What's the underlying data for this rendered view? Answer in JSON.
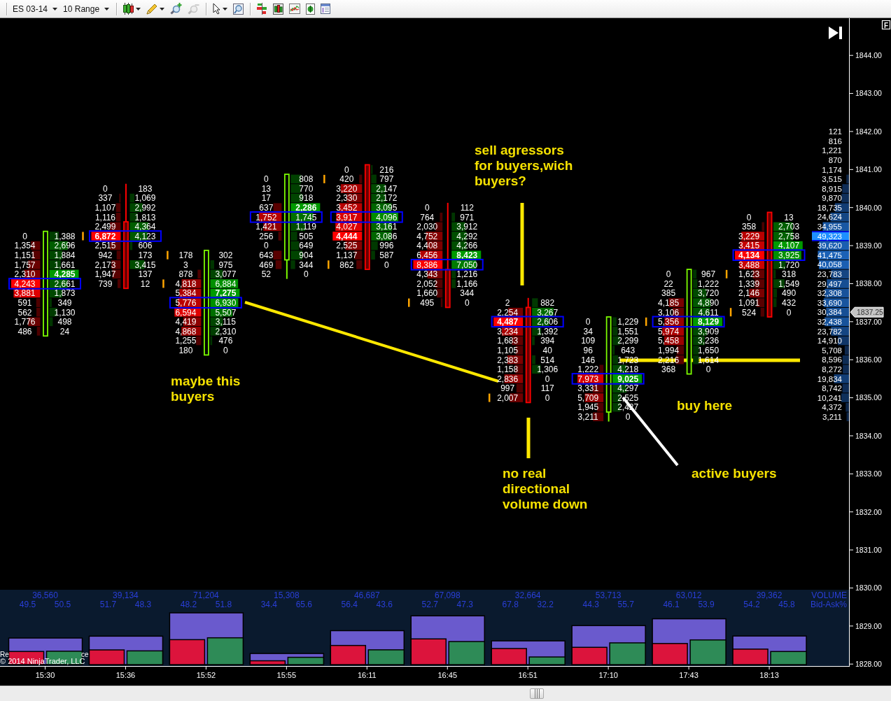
{
  "toolbar": {
    "instrument": "ES 03-14",
    "bar_type": "10 Range",
    "tool_groups": [
      [
        {
          "kind": "chart-style",
          "menu": true,
          "disabled": false
        },
        {
          "kind": "draw",
          "menu": true,
          "disabled": false
        },
        {
          "kind": "zoom-in",
          "menu": false,
          "disabled": false
        },
        {
          "kind": "zoom-out",
          "menu": false,
          "disabled": true
        }
      ],
      [
        {
          "kind": "pointer",
          "menu": true,
          "disabled": false
        },
        {
          "kind": "magnifier",
          "menu": false,
          "disabled": false
        }
      ],
      [
        {
          "kind": "volume-bars",
          "menu": false,
          "disabled": false
        },
        {
          "kind": "candles",
          "menu": false,
          "disabled": false
        },
        {
          "kind": "lines",
          "menu": false,
          "disabled": false
        },
        {
          "kind": "money",
          "menu": false,
          "disabled": false
        },
        {
          "kind": "panel",
          "menu": false,
          "disabled": false
        }
      ]
    ]
  },
  "chart": {
    "panel_flag": "F",
    "price_axis": [
      "1844.00",
      "1843.00",
      "1842.00",
      "1841.00",
      "1840.00",
      "1839.00",
      "1838.00",
      "1837.00",
      "1836.00",
      "1835.00",
      "1834.00",
      "1833.00",
      "1832.00",
      "1831.00",
      "1830.00",
      "1829.00",
      "1828.00"
    ],
    "last_price": "1837.25",
    "bars": [
      {
        "time": "15:30",
        "rising": true,
        "bid": [
          "0",
          "1,354",
          "1,151",
          "1,757",
          "2,310",
          "4,243",
          "3,881",
          "591",
          "562",
          "1,776",
          "486"
        ],
        "ask": [
          "1,388",
          "2,696",
          "1,884",
          "1,661",
          "4,285",
          "2,661",
          "1,873",
          "349",
          "1,130",
          "498",
          "24"
        ],
        "volume": "36,560",
        "bid_pct": "49.5",
        "ask_pct": "50.5"
      },
      {
        "time": "15:36",
        "rising": false,
        "bid": [
          "0",
          "337",
          "1,107",
          "1,116",
          "2,499",
          "6,872",
          "2,515",
          "942",
          "2,173",
          "1,947",
          "739"
        ],
        "ask": [
          "183",
          "1,069",
          "2,992",
          "1,813",
          "4,364",
          "4,123",
          "606",
          "173",
          "3,415",
          "137",
          "12"
        ],
        "volume": "39,134",
        "bid_pct": "51.7",
        "ask_pct": "48.3"
      },
      {
        "time": "15:52",
        "rising": true,
        "bid": [
          "178",
          "3",
          "878",
          "4,818",
          "5,384",
          "5,776",
          "6,594",
          "4,419",
          "4,868",
          "1,255",
          "180"
        ],
        "ask": [
          "302",
          "975",
          "3,077",
          "6,884",
          "7,275",
          "6,930",
          "5,507",
          "3,115",
          "2,310",
          "476",
          "0"
        ],
        "volume": "71,204",
        "bid_pct": "48.2",
        "ask_pct": "51.8"
      },
      {
        "time": "15:55",
        "rising": true,
        "bid": [
          "0",
          "13",
          "17",
          "637",
          "1,752",
          "1,421",
          "256",
          "0",
          "643",
          "469",
          "52"
        ],
        "ask": [
          "808",
          "770",
          "918",
          "2,286",
          "1,745",
          "1,119",
          "505",
          "649",
          "904",
          "344",
          "0"
        ],
        "volume": "15,308",
        "bid_pct": "34.4",
        "ask_pct": "65.6"
      },
      {
        "time": "16:11",
        "rising": false,
        "bid": [
          "0",
          "420",
          "3,220",
          "2,330",
          "3,452",
          "3,917",
          "4,027",
          "4,444",
          "2,525",
          "1,137",
          "862"
        ],
        "ask": [
          "216",
          "797",
          "2,147",
          "2,172",
          "3,095",
          "4,096",
          "3,161",
          "3,086",
          "996",
          "587",
          "0"
        ],
        "volume": "46,687",
        "bid_pct": "56.4",
        "ask_pct": "43.6"
      },
      {
        "time": "16:45",
        "rising": false,
        "bid": [
          "0",
          "764",
          "2,030",
          "4,752",
          "4,408",
          "6,456",
          "8,386",
          "4,343",
          "2,052",
          "1,660",
          "495"
        ],
        "ask": [
          "112",
          "971",
          "3,912",
          "4,292",
          "4,266",
          "8,423",
          "7,050",
          "1,216",
          "1,166",
          "344",
          "0"
        ],
        "volume": "67,098",
        "bid_pct": "52.7",
        "ask_pct": "47.3"
      },
      {
        "time": "16:51",
        "rising": false,
        "bid": [
          "2",
          "2,254",
          "4,487",
          "3,234",
          "1,683",
          "1,105",
          "2,383",
          "1,158",
          "2,836",
          "997",
          "2,007"
        ],
        "ask": [
          "882",
          "3,267",
          "2,606",
          "1,392",
          "394",
          "40",
          "514",
          "1,306",
          "0",
          "117",
          "0"
        ],
        "volume": "32,664",
        "bid_pct": "67.8",
        "ask_pct": "32.2"
      },
      {
        "time": "17:10",
        "rising": true,
        "bid": [
          "0",
          "34",
          "109",
          "96",
          "146",
          "1,222",
          "7,973",
          "3,331",
          "5,709",
          "1,945",
          "3,211"
        ],
        "ask": [
          "1,229",
          "1,551",
          "2,299",
          "643",
          "1,723",
          "4,218",
          "9,025",
          "4,297",
          "2,525",
          "2,427",
          "0"
        ],
        "volume": "53,713",
        "bid_pct": "44.3",
        "ask_pct": "55.7"
      },
      {
        "time": "17:43",
        "rising": true,
        "bid": [
          "0",
          "22",
          "385",
          "4,185",
          "3,106",
          "5,356",
          "5,974",
          "5,458",
          "1,994",
          "2,216",
          "368"
        ],
        "ask": [
          "967",
          "1,222",
          "3,720",
          "4,890",
          "4,611",
          "8,129",
          "3,909",
          "3,236",
          "1,650",
          "1,614",
          "0"
        ],
        "volume": "63,012",
        "bid_pct": "46.1",
        "ask_pct": "53.9"
      },
      {
        "time": "18:13",
        "rising": false,
        "bid": [
          "0",
          "358",
          "3,229",
          "3,415",
          "4,134",
          "3,488",
          "1,623",
          "1,339",
          "2,146",
          "1,091",
          "524"
        ],
        "ask": [
          "13",
          "2,703",
          "2,758",
          "4,107",
          "3,925",
          "1,720",
          "318",
          "1,549",
          "490",
          "432",
          "0"
        ],
        "volume": "39,362",
        "bid_pct": "54.2",
        "ask_pct": "45.8"
      }
    ],
    "volume_profile": [
      "121",
      "816",
      "1,221",
      "870",
      "1,174",
      "3,515",
      "8,915",
      "9,870",
      "18,735",
      "24,624",
      "34,955",
      "49,323",
      "39,620",
      "41,475",
      "40,058",
      "23,783",
      "29,497",
      "32,308",
      "33,690",
      "30,384",
      "32,438",
      "23,782",
      "14,910",
      "5,708",
      "8,596",
      "8,272",
      "19,834",
      "8,742",
      "10,241",
      "4,372",
      "3,211"
    ],
    "volume_panel": {
      "title": "VOLUME",
      "subtitle": "Bid-Ask%"
    },
    "annotations": [
      {
        "lines": [
          "sell agressors",
          "for buyers,wich",
          "buyers?"
        ]
      },
      {
        "lines": [
          "maybe this",
          "buyers"
        ]
      },
      {
        "lines": [
          "no real",
          "directional",
          "volume down"
        ]
      },
      {
        "lines": [
          "buy here"
        ]
      },
      {
        "lines": [
          "active buyers"
        ]
      }
    ],
    "status_fragments": [
      "Re",
      "ce"
    ],
    "copyright": "© 2014 NinjaTrader, LLC"
  }
}
